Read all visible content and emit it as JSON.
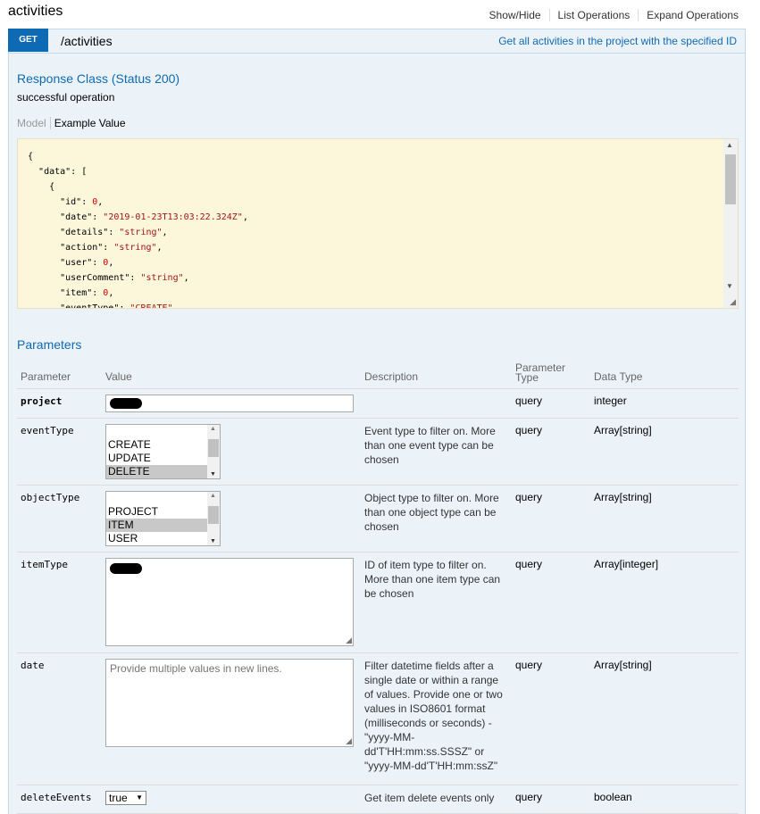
{
  "resource": {
    "title": "activities",
    "links": [
      "Show/Hide",
      "List Operations",
      "Expand Operations"
    ]
  },
  "operation": {
    "method": "GET",
    "path": "/activities",
    "summary": "Get all activities in the project with the specified ID"
  },
  "response": {
    "heading": "Response Class (Status 200)",
    "message": "successful operation",
    "tab_model": "Model",
    "tab_example": "Example Value"
  },
  "parameters": {
    "heading": "Parameters",
    "columns": {
      "parameter": "Parameter",
      "value": "Value",
      "description": "Description",
      "param_type": "Parameter Type",
      "data_type": "Data Type"
    },
    "rows": [
      {
        "name": "project",
        "required": true,
        "control": "text",
        "description": "",
        "param_type": "query",
        "data_type": "integer"
      },
      {
        "name": "eventType",
        "control": "multiselect",
        "options": [
          "CREATE",
          "UPDATE",
          "DELETE"
        ],
        "selected": "DELETE",
        "description": "Event type to filter on. More than one event type can be chosen",
        "param_type": "query",
        "data_type": "Array[string]"
      },
      {
        "name": "objectType",
        "control": "multiselect",
        "options": [
          "PROJECT",
          "ITEM",
          "USER"
        ],
        "selected": "ITEM",
        "description": "Object type to filter on. More than one object type can be chosen",
        "param_type": "query",
        "data_type": "Array[string]"
      },
      {
        "name": "itemType",
        "control": "textarea",
        "placeholder": "",
        "description": "ID of item type to filter on. More than one item type can be chosen",
        "param_type": "query",
        "data_type": "Array[integer]"
      },
      {
        "name": "date",
        "control": "textarea",
        "placeholder": "Provide multiple values in new lines.",
        "description": "Filter datetime fields after a single date or within a range of values. Provide one or two values in ISO8601 format (milliseconds or seconds) - \"yyyy-MM-dd'T'HH:mm:ss.SSSZ\" or \"yyyy-MM-dd'T'HH:mm:ssZ\"",
        "param_type": "query",
        "data_type": "Array[string]"
      },
      {
        "name": "deleteEvents",
        "control": "select",
        "value": "true",
        "description": "Get item delete events only",
        "param_type": "query",
        "data_type": "boolean"
      }
    ]
  },
  "example_json_lines": [
    {
      "indent": 0,
      "text": "{"
    },
    {
      "indent": 1,
      "key": "\"data\"",
      "rest": ": ["
    },
    {
      "indent": 2,
      "text": "{"
    },
    {
      "indent": 3,
      "key": "\"id\"",
      "num": "0"
    },
    {
      "indent": 3,
      "key": "\"date\"",
      "str": "\"2019-01-23T13:03:22.324Z\""
    },
    {
      "indent": 3,
      "key": "\"details\"",
      "str": "\"string\""
    },
    {
      "indent": 3,
      "key": "\"action\"",
      "str": "\"string\""
    },
    {
      "indent": 3,
      "key": "\"user\"",
      "num": "0"
    },
    {
      "indent": 3,
      "key": "\"userComment\"",
      "str": "\"string\""
    },
    {
      "indent": 3,
      "key": "\"item\"",
      "num": "0"
    },
    {
      "indent": 3,
      "key": "\"eventType\"",
      "str": "\"CREATE\""
    }
  ]
}
